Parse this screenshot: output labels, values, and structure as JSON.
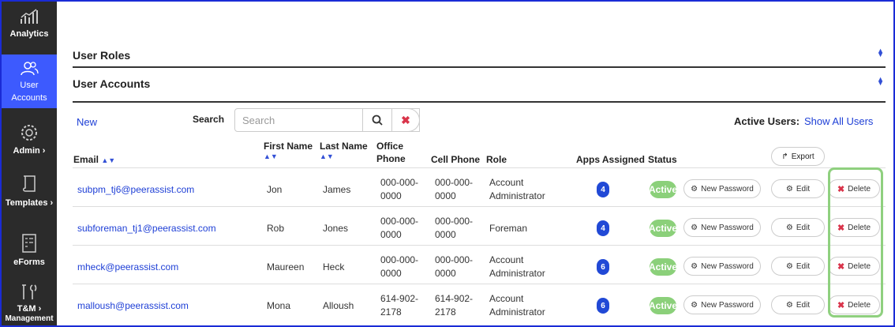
{
  "sidebar": {
    "items": [
      {
        "label": "Analytics",
        "icon": "chart-icon"
      },
      {
        "label": "User Accounts",
        "icon": "users-icon"
      },
      {
        "label": "Admin ›",
        "icon": "gear-icon"
      },
      {
        "label": "Templates ›",
        "icon": "scroll-icon"
      },
      {
        "label": "eForms",
        "icon": "form-icon"
      },
      {
        "label": "T&M  ›",
        "label2": "Management",
        "icon": "tools-icon"
      }
    ]
  },
  "sections": {
    "roles_title": "User Roles",
    "accounts_title": "User Accounts"
  },
  "toolbar": {
    "new_label": "New",
    "search_label": "Search",
    "search_placeholder": "Search",
    "active_users_label": "Active Users:",
    "show_all_label": "Show All Users",
    "export_label": "Export"
  },
  "table": {
    "headers": {
      "email": "Email",
      "first_name": "First Name",
      "last_name": "Last Name",
      "office_phone_1": "Office",
      "office_phone_2": "Phone",
      "cell_phone": "Cell Phone",
      "role": "Role",
      "apps": "Apps Assigned",
      "status": "Status"
    },
    "rows": [
      {
        "email": "subpm_tj6@peerassist.com",
        "first": "Jon",
        "last": "James",
        "office1": "000-000-",
        "office2": "0000",
        "cell1": "000-000-",
        "cell2": "0000",
        "role1": "Account",
        "role2": "Administrator",
        "apps": "4",
        "status": "Active",
        "new_password": "New Password",
        "edit": "Edit",
        "delete": "Delete"
      },
      {
        "email": "subforeman_tj1@peerassist.com",
        "first": "Rob",
        "last": "Jones",
        "office1": "000-000-",
        "office2": "0000",
        "cell1": "000-000-",
        "cell2": "0000",
        "role1": "Foreman",
        "role2": "",
        "apps": "4",
        "status": "Active",
        "new_password": "New Password",
        "edit": "Edit",
        "delete": "Delete"
      },
      {
        "email": "mheck@peerassist.com",
        "first": "Maureen",
        "last": "Heck",
        "office1": "000-000-",
        "office2": "0000",
        "cell1": "000-000-",
        "cell2": "0000",
        "role1": "Account",
        "role2": "Administrator",
        "apps": "6",
        "status": "Active",
        "new_password": "New Password",
        "edit": "Edit",
        "delete": "Delete"
      },
      {
        "email": "malloush@peerassist.com",
        "first": "Mona",
        "last": "Alloush",
        "office1": "614-902-",
        "office2": "2178",
        "cell1": "614-902-",
        "cell2": "2178",
        "role1": "Account",
        "role2": "Administrator",
        "apps": "6",
        "status": "Active",
        "new_password": "New Password",
        "edit": "Edit",
        "delete": "Delete"
      }
    ]
  },
  "colors": {
    "accent": "#3d5afe",
    "link": "#1e3fd6",
    "sidebar": "#2b2b2b",
    "active_status": "#8bd07a",
    "delete": "#d9344a",
    "highlight": "#8fd07f"
  }
}
